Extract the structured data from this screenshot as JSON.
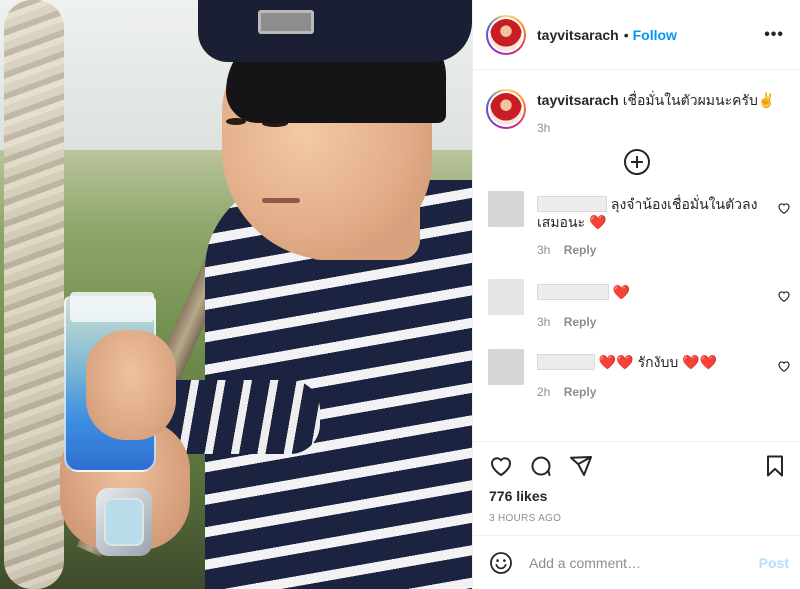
{
  "header": {
    "username": "tayvitsarach",
    "separator": "•",
    "follow_label": "Follow",
    "more_label": "•••"
  },
  "caption": {
    "username": "tayvitsarach",
    "text": "เชื่อมั่นในตัวผมนะครับ✌️",
    "time": "3h"
  },
  "comments": [
    {
      "text_line1": "ลุงจำน้องเชื่อมั่นในตัวลง",
      "text_line2": "เสมอนะ ❤️",
      "time": "3h",
      "reply_label": "Reply"
    },
    {
      "text": "❤️",
      "time": "3h",
      "reply_label": "Reply"
    },
    {
      "text": "❤️❤️ รักงับบ ❤️❤️",
      "time": "2h",
      "reply_label": "Reply"
    }
  ],
  "likes": "776 likes",
  "time_ago": "3 HOURS AGO",
  "add_comment": {
    "placeholder": "Add a comment…",
    "post_label": "Post"
  },
  "icons": {
    "more": "more-options-icon",
    "load_more": "load-more-comments-icon",
    "like": "heart-icon",
    "comment": "comment-icon",
    "share": "share-icon",
    "save": "bookmark-icon",
    "emoji": "emoji-icon"
  },
  "colors": {
    "accent": "#0095f6",
    "post_disabled": "#b2dffc",
    "muted": "#8e8e8e"
  }
}
